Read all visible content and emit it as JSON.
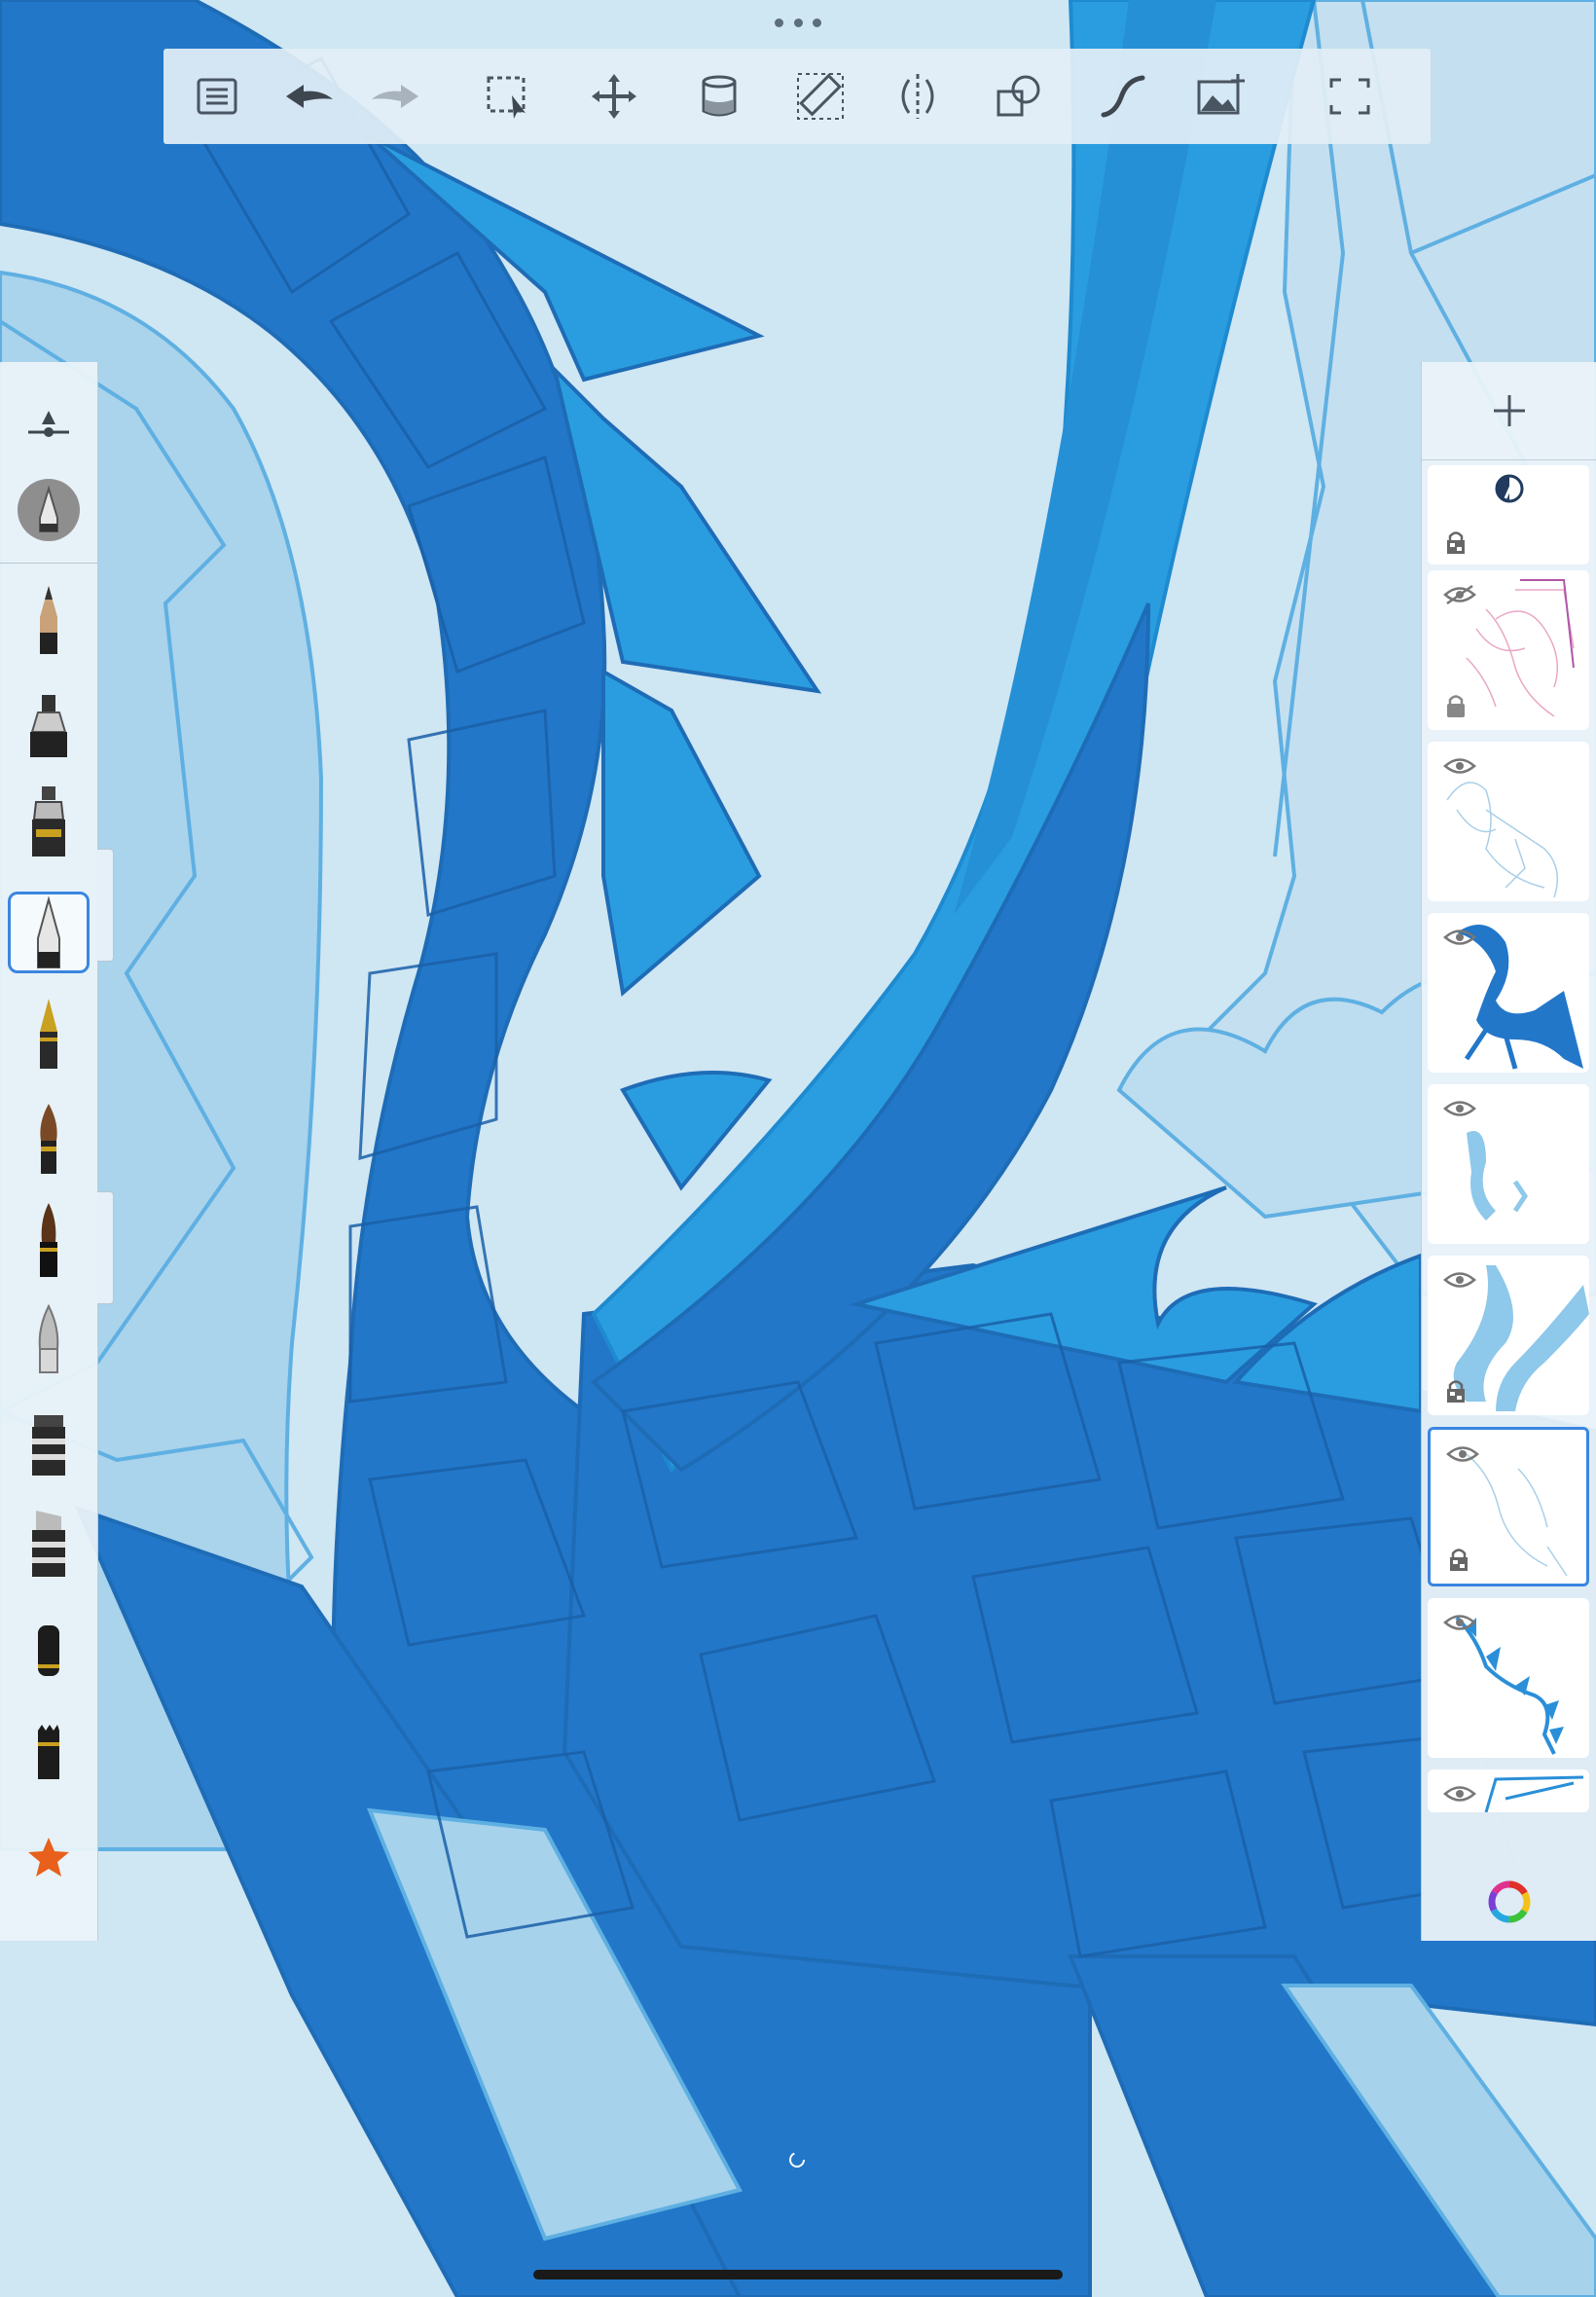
{
  "app": {
    "colors": {
      "canvas_bg": "#cfe6f3",
      "dragon_dark": "#2277c9",
      "dragon_mid": "#2a9de0",
      "dragon_light": "#a7d2ec",
      "accent": "#3a86e0"
    }
  },
  "toolbar": {
    "tools": [
      {
        "icon": "list-icon"
      },
      {
        "icon": "undo-icon"
      },
      {
        "icon": "redo-icon"
      },
      {
        "icon": "selection-icon"
      },
      {
        "icon": "transform-icon"
      },
      {
        "icon": "fill-bucket-icon"
      },
      {
        "icon": "ruler-icon"
      },
      {
        "icon": "symmetry-icon"
      },
      {
        "icon": "shapes-icon"
      },
      {
        "icon": "curve-icon"
      },
      {
        "icon": "add-image-icon"
      },
      {
        "icon": "fullscreen-icon"
      }
    ]
  },
  "brushes": [
    {
      "icon": "brush-size-slider-icon"
    },
    {
      "icon": "current-brush-icon"
    },
    {
      "icon": "pencil-icon"
    },
    {
      "icon": "marker-icon"
    },
    {
      "icon": "airbrush-icon"
    },
    {
      "icon": "ballpoint-icon",
      "selected": true
    },
    {
      "icon": "fountain-pen-icon"
    },
    {
      "icon": "paintbrush-icon"
    },
    {
      "icon": "ink-brush-icon"
    },
    {
      "icon": "smudge-icon"
    },
    {
      "icon": "chisel-marker-icon"
    },
    {
      "icon": "wide-marker-icon"
    },
    {
      "icon": "black-marker-icon"
    },
    {
      "icon": "eraser-icon"
    },
    {
      "icon": "favorite-star-icon"
    }
  ],
  "layers": [
    {
      "visible": true,
      "locked": "alpha",
      "kind": "blend-mode"
    },
    {
      "visible": false,
      "locked": "lock",
      "kind": "sketch-pink"
    },
    {
      "visible": true,
      "locked": "none",
      "kind": "sketch-light"
    },
    {
      "visible": true,
      "locked": "none",
      "kind": "dragon-dark"
    },
    {
      "visible": true,
      "locked": "none",
      "kind": "legs-light"
    },
    {
      "visible": true,
      "locked": "alpha",
      "kind": "horns"
    },
    {
      "visible": true,
      "locked": "alpha",
      "kind": "faint-lines",
      "active": true
    },
    {
      "visible": true,
      "locked": "none",
      "kind": "spikes"
    },
    {
      "visible": true,
      "locked": "none",
      "kind": "wing-partial"
    }
  ]
}
